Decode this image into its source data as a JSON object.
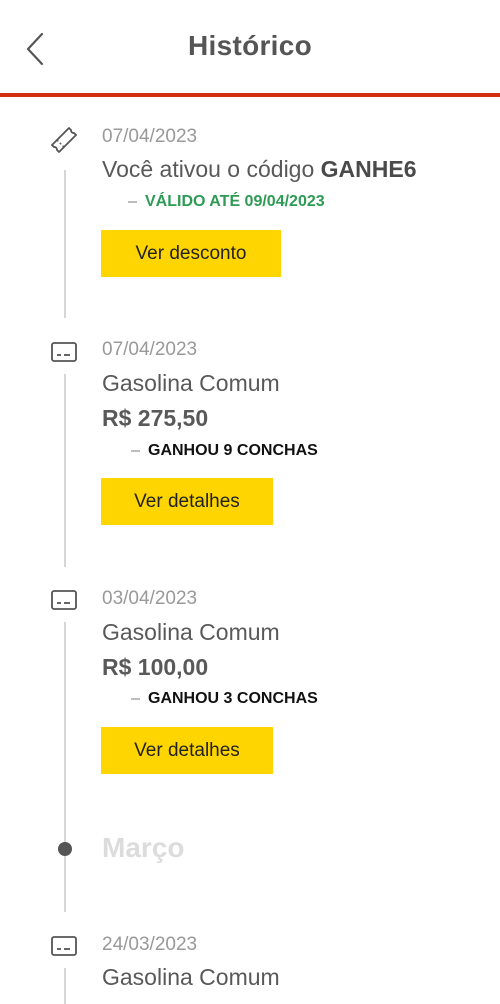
{
  "header": {
    "title": "Histórico"
  },
  "history": [
    {
      "type": "code",
      "date": "07/04/2023",
      "text_prefix": "Você ativou o código ",
      "code": "GANHE6",
      "tag": "VÁLIDO ATÉ 09/04/2023",
      "button_label": "Ver desconto"
    },
    {
      "type": "purchase",
      "date": "07/04/2023",
      "product": "Gasolina Comum",
      "amount": "R$ 275,50",
      "tag": "GANHOU 9 CONCHAS",
      "button_label": "Ver detalhes"
    },
    {
      "type": "purchase",
      "date": "03/04/2023",
      "product": "Gasolina Comum",
      "amount": "R$ 100,00",
      "tag": "GANHOU 3 CONCHAS",
      "button_label": "Ver detalhes"
    },
    {
      "type": "purchase",
      "date": "24/03/2023",
      "product": "Gasolina Comum"
    }
  ],
  "month_separator": "Março",
  "colors": {
    "accent_red": "#D42E12",
    "button_yellow": "#FFD500",
    "valid_green": "#2E9B55"
  },
  "icons": {
    "back": "chevron-left-icon",
    "code": "ticket-icon",
    "purchase": "card-icon"
  }
}
